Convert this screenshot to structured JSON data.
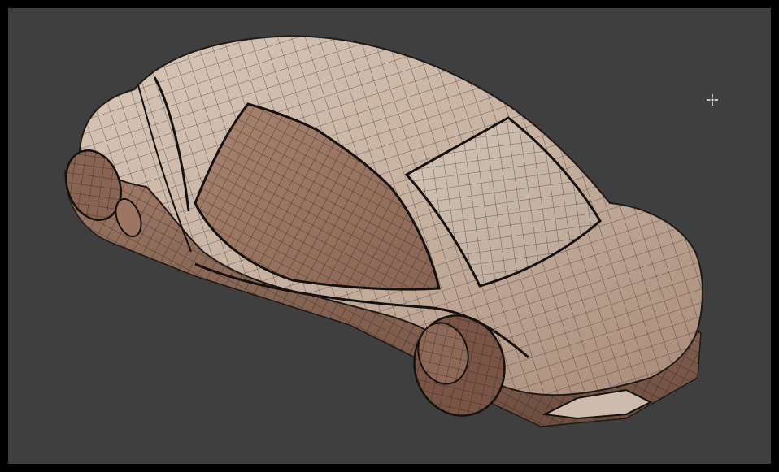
{
  "viewport": {
    "background_color": "#3f3f3f",
    "frame_color": "#000000",
    "cursor_icon": "crosshair-cursor-icon"
  },
  "model": {
    "name": "car-wireframe-model",
    "body_color": "#c9b3a2",
    "shadow_color": "#8a6250",
    "glass_color": "#9c7663",
    "wire_color": "#1e1a18"
  }
}
